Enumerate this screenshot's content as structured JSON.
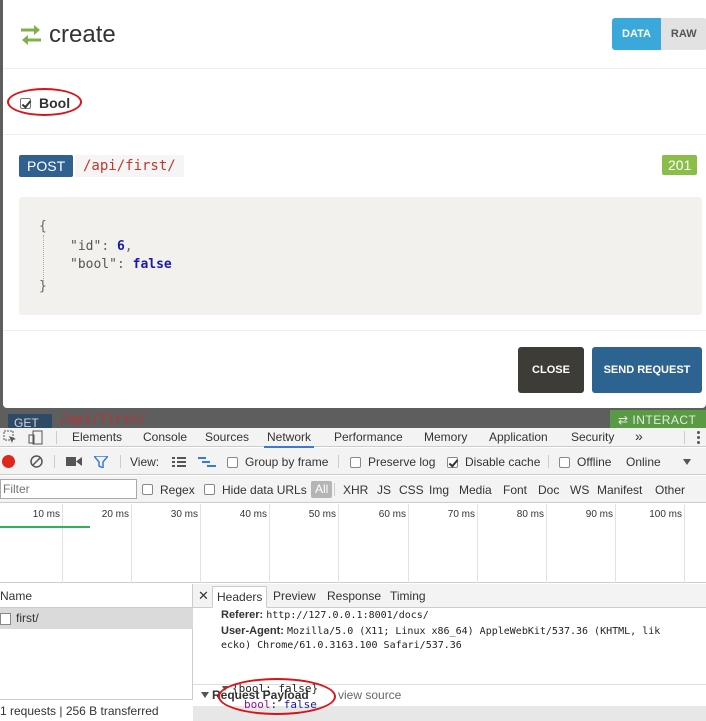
{
  "modal": {
    "title": "create",
    "view_toggle": {
      "data": "DATA",
      "raw": "RAW"
    },
    "checkbox": {
      "label": "Bool",
      "checked": true
    },
    "request": {
      "method": "POST",
      "path": "/api/first/",
      "status": "201"
    },
    "response_body": {
      "open": "{",
      "line1_key": "\"id\"",
      "line1_value": "6",
      "line1_sep": ",",
      "line2_key": "\"bool\"",
      "line2_value": "false",
      "close": "}"
    },
    "buttons": {
      "close": "CLOSE",
      "send": "SEND REQUEST"
    }
  },
  "background": {
    "method": "GET",
    "path": "/api/first/",
    "interact": "⇄ INTERACT"
  },
  "devtools": {
    "tabs": [
      "Elements",
      "Console",
      "Sources",
      "Network",
      "Performance",
      "Memory",
      "Application",
      "Security"
    ],
    "selected_tab": "Network",
    "more_tabs": "»",
    "toolbar": {
      "view_label": "View:",
      "group_by_frame": "Group by frame",
      "preserve_log": "Preserve log",
      "disable_cache": "Disable cache",
      "offline": "Offline",
      "throttling": "Online"
    },
    "filter": {
      "placeholder": "Filter",
      "regex": "Regex",
      "hide_data_urls": "Hide data URLs",
      "types": [
        "All",
        "XHR",
        "JS",
        "CSS",
        "Img",
        "Media",
        "Font",
        "Doc",
        "WS",
        "Manifest",
        "Other"
      ]
    },
    "timeline_ticks": [
      "10 ms",
      "20 ms",
      "30 ms",
      "40 ms",
      "50 ms",
      "60 ms",
      "70 ms",
      "80 ms",
      "90 ms",
      "100 ms"
    ],
    "requests": {
      "column_name": "Name",
      "rows": [
        "first/"
      ],
      "summary": "1 requests  |  256 B transferred"
    },
    "detail": {
      "close": "✕",
      "tabs": [
        "Headers",
        "Preview",
        "Response",
        "Timing"
      ],
      "selected_tab": "Headers",
      "referer_label": "Referer:",
      "referer_value": "http://127.0.0.1:8001/docs/",
      "ua_label": "User-Agent:",
      "ua_value_1": "Mozilla/5.0 (X11; Linux x86_64) AppleWebKit/537.36 (KHTML, lik",
      "ua_value_2": "ecko) Chrome/61.0.3163.100 Safari/537.36",
      "payload_heading": "Request Payload",
      "view_source": "view source",
      "payload_object": "{bool: false}",
      "payload_key": "bool",
      "payload_value": "false"
    }
  },
  "colors": {
    "primary": "#2f6090",
    "accent": "#3aa8db",
    "success": "#8bbd4b",
    "annotation": "#d8141a"
  }
}
